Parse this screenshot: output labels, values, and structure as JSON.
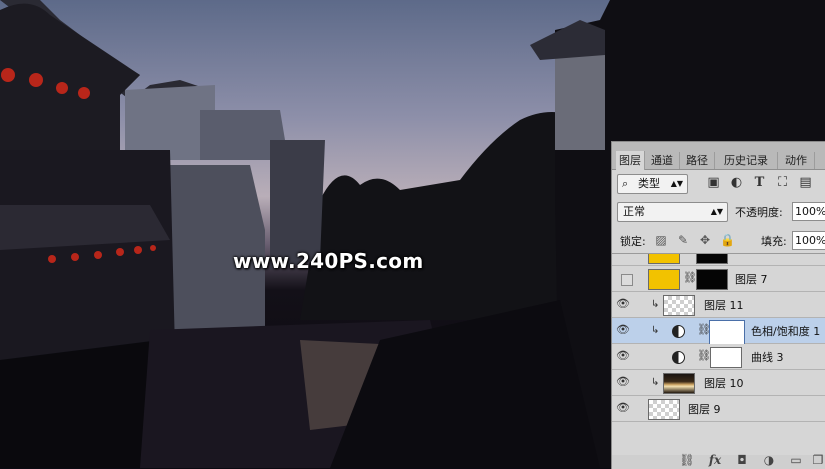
{
  "watermark": "www.240PS.com",
  "panel": {
    "tabs": [
      "图层",
      "通道",
      "路径",
      "历史记录",
      "动作"
    ],
    "filter": {
      "kind_label": "类型",
      "icons": [
        "image-filter-icon",
        "adjustment-filter-icon",
        "type-filter-icon",
        "shape-filter-icon",
        "smart-object-filter-icon"
      ]
    },
    "blend_mode": "正常",
    "opacity_label": "不透明度:",
    "opacity_value": "100%",
    "lock_label": "锁定:",
    "fill_label": "填充:",
    "fill_value": "100%",
    "layers": [
      {
        "name": "图层 7",
        "visible": false,
        "clipped": false,
        "type": "masked",
        "thumb": "yellow",
        "mask": "black"
      },
      {
        "name": "图层 11",
        "visible": true,
        "clipped": true,
        "type": "pixel",
        "thumb": "checker"
      },
      {
        "name": "色相/饱和度 1",
        "visible": true,
        "clipped": true,
        "type": "adjustment",
        "mask": "white",
        "selected": true
      },
      {
        "name": "曲线 3",
        "visible": true,
        "clipped": false,
        "type": "adjustment",
        "mask": "white"
      },
      {
        "name": "图层 10",
        "visible": true,
        "clipped": true,
        "type": "pixel",
        "thumb": "photo"
      },
      {
        "name": "图层 9",
        "visible": true,
        "clipped": false,
        "type": "pixel",
        "thumb": "checker"
      }
    ],
    "bottom_icons": [
      "link-layers-icon",
      "fx-icon",
      "add-mask-icon",
      "new-adjustment-icon",
      "new-group-icon",
      "new-layer-icon"
    ]
  }
}
